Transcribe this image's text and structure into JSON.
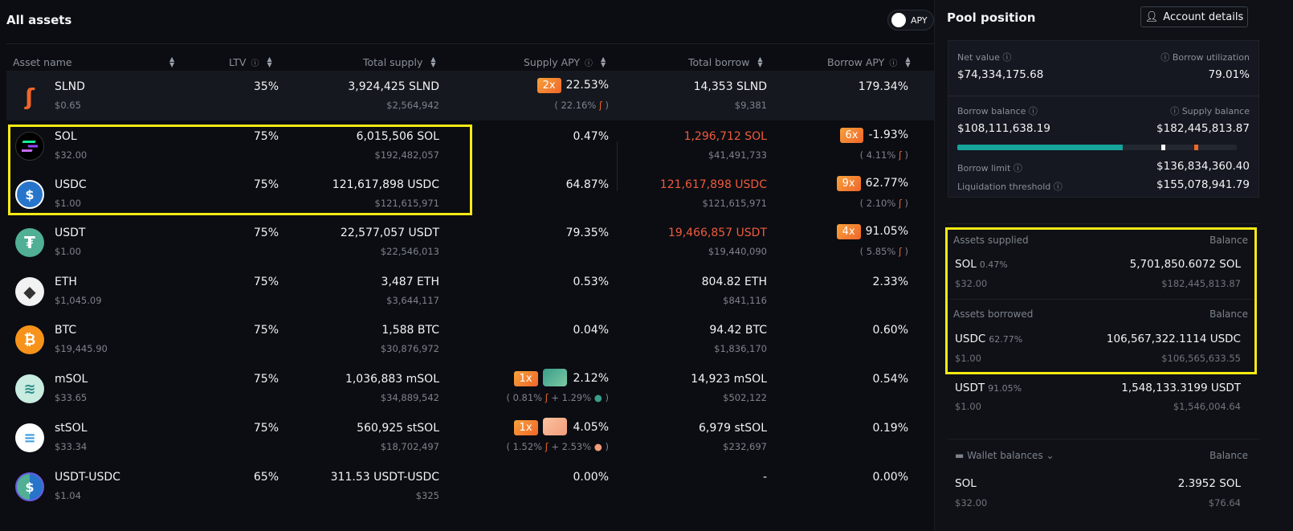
{
  "left": {
    "title": "All assets",
    "apy_toggle_label": "APY",
    "headers": {
      "asset_name": "Asset name",
      "ltv": "LTV",
      "total_supply": "Total supply",
      "supply_apy": "Supply APY",
      "total_borrow": "Total borrow",
      "borrow_apy": "Borrow APY"
    },
    "rows": [
      {
        "name": "SLND",
        "price": "$0.65",
        "ltv": "35%",
        "supply": "3,924,425 SLND",
        "supply_usd": "$2,564,942",
        "supply_mult": "2x",
        "supply_apy": "22.53%",
        "supply_apy_sub": "( 22.16%",
        "borrow": "14,353 SLND",
        "borrow_usd": "$9,381",
        "borrow_apy": "179.34%"
      },
      {
        "name": "SOL",
        "price": "$32.00",
        "ltv": "75%",
        "supply": "6,015,506 SOL",
        "supply_usd": "$192,482,057",
        "supply_apy": "0.47%",
        "borrow": "1,296,712 SOL",
        "borrow_usd": "$41,491,733",
        "borrow_mult": "6x",
        "borrow_apy": "-1.93%",
        "borrow_apy_sub": "( 4.11%"
      },
      {
        "name": "USDC",
        "price": "$1.00",
        "ltv": "75%",
        "supply": "121,617,898 USDC",
        "supply_usd": "$121,615,971",
        "supply_apy": "64.87%",
        "borrow": "121,617,898 USDC",
        "borrow_usd": "$121,615,971",
        "borrow_mult": "9x",
        "borrow_apy": "62.77%",
        "borrow_apy_sub": "( 2.10%"
      },
      {
        "name": "USDT",
        "price": "$1.00",
        "ltv": "75%",
        "supply": "22,577,057 USDT",
        "supply_usd": "$22,546,013",
        "supply_apy": "79.35%",
        "borrow": "19,466,857 USDT",
        "borrow_usd": "$19,440,090",
        "borrow_mult": "4x",
        "borrow_apy": "91.05%",
        "borrow_apy_sub": "( 5.85%"
      },
      {
        "name": "ETH",
        "price": "$1,045.09",
        "ltv": "75%",
        "supply": "3,487 ETH",
        "supply_usd": "$3,644,117",
        "supply_apy": "0.53%",
        "borrow": "804.82 ETH",
        "borrow_usd": "$841,116",
        "borrow_apy": "2.33%"
      },
      {
        "name": "BTC",
        "price": "$19,445.90",
        "ltv": "75%",
        "supply": "1,588 BTC",
        "supply_usd": "$30,876,972",
        "supply_apy": "0.04%",
        "borrow": "94.42 BTC",
        "borrow_usd": "$1,836,170",
        "borrow_apy": "0.60%"
      },
      {
        "name": "mSOL",
        "price": "$33.65",
        "ltv": "75%",
        "supply": "1,036,883 mSOL",
        "supply_usd": "$34,889,542",
        "supply_mult": "1x",
        "supply_apy": "2.12%",
        "supply_apy_sub": "( 0.81%",
        "supply_apy_sub2": "+ 1.29%",
        "borrow": "14,923 mSOL",
        "borrow_usd": "$502,122",
        "borrow_apy": "0.54%"
      },
      {
        "name": "stSOL",
        "price": "$33.34",
        "ltv": "75%",
        "supply": "560,925 stSOL",
        "supply_usd": "$18,702,497",
        "supply_mult": "1x",
        "supply_apy": "4.05%",
        "supply_apy_sub": "( 1.52%",
        "supply_apy_sub2": "+ 2.53%",
        "borrow": "6,979 stSOL",
        "borrow_usd": "$232,697",
        "borrow_apy": "0.19%"
      },
      {
        "name": "USDT-USDC",
        "price": "$1.04",
        "ltv": "65%",
        "supply": "311.53 USDT-USDC",
        "supply_usd": "$325",
        "supply_apy": "0.00%",
        "borrow": "-",
        "borrow_apy": "0.00%"
      }
    ]
  },
  "right": {
    "title": "Pool position",
    "account_button": "Account details",
    "net_value_label": "Net value",
    "net_value": "$74,334,175.68",
    "borrow_util_label": "Borrow utilization",
    "borrow_util": "79.01%",
    "borrow_balance_label": "Borrow balance",
    "borrow_balance": "$108,111,638.19",
    "supply_balance_label": "Supply balance",
    "supply_balance": "$182,445,813.87",
    "borrow_limit_label": "Borrow limit",
    "borrow_limit": "$136,834,360.40",
    "liq_threshold_label": "Liquidation threshold",
    "liq_threshold": "$155,078,941.79",
    "bar_fill_fraction": 0.5926,
    "supplied_label": "Assets supplied",
    "balance_label": "Balance",
    "supplied": [
      {
        "name": "SOL",
        "apy": "0.47%",
        "price": "$32.00",
        "amount": "5,701,850.6072 SOL",
        "usd": "$182,445,813.87"
      }
    ],
    "borrowed_label": "Assets borrowed",
    "borrowed": [
      {
        "name": "USDC",
        "apy": "62.77%",
        "price": "$1.00",
        "amount": "106,567,322.1114 USDC",
        "usd": "$106,565,633.55"
      },
      {
        "name": "USDT",
        "apy": "91.05%",
        "price": "$1.00",
        "amount": "1,548,133.3199 USDT",
        "usd": "$1,546,004.64"
      }
    ],
    "wallet_label": "Wallet balances",
    "wallet": [
      {
        "name": "SOL",
        "price": "$32.00",
        "amount": "2.3952 SOL",
        "usd": "$76.64"
      }
    ]
  },
  "colors": {
    "accent_orange": "#f0662a",
    "highlight_yellow": "#f7ea14",
    "borrow_red": "#f05a3c",
    "teal": "#15a39a"
  }
}
